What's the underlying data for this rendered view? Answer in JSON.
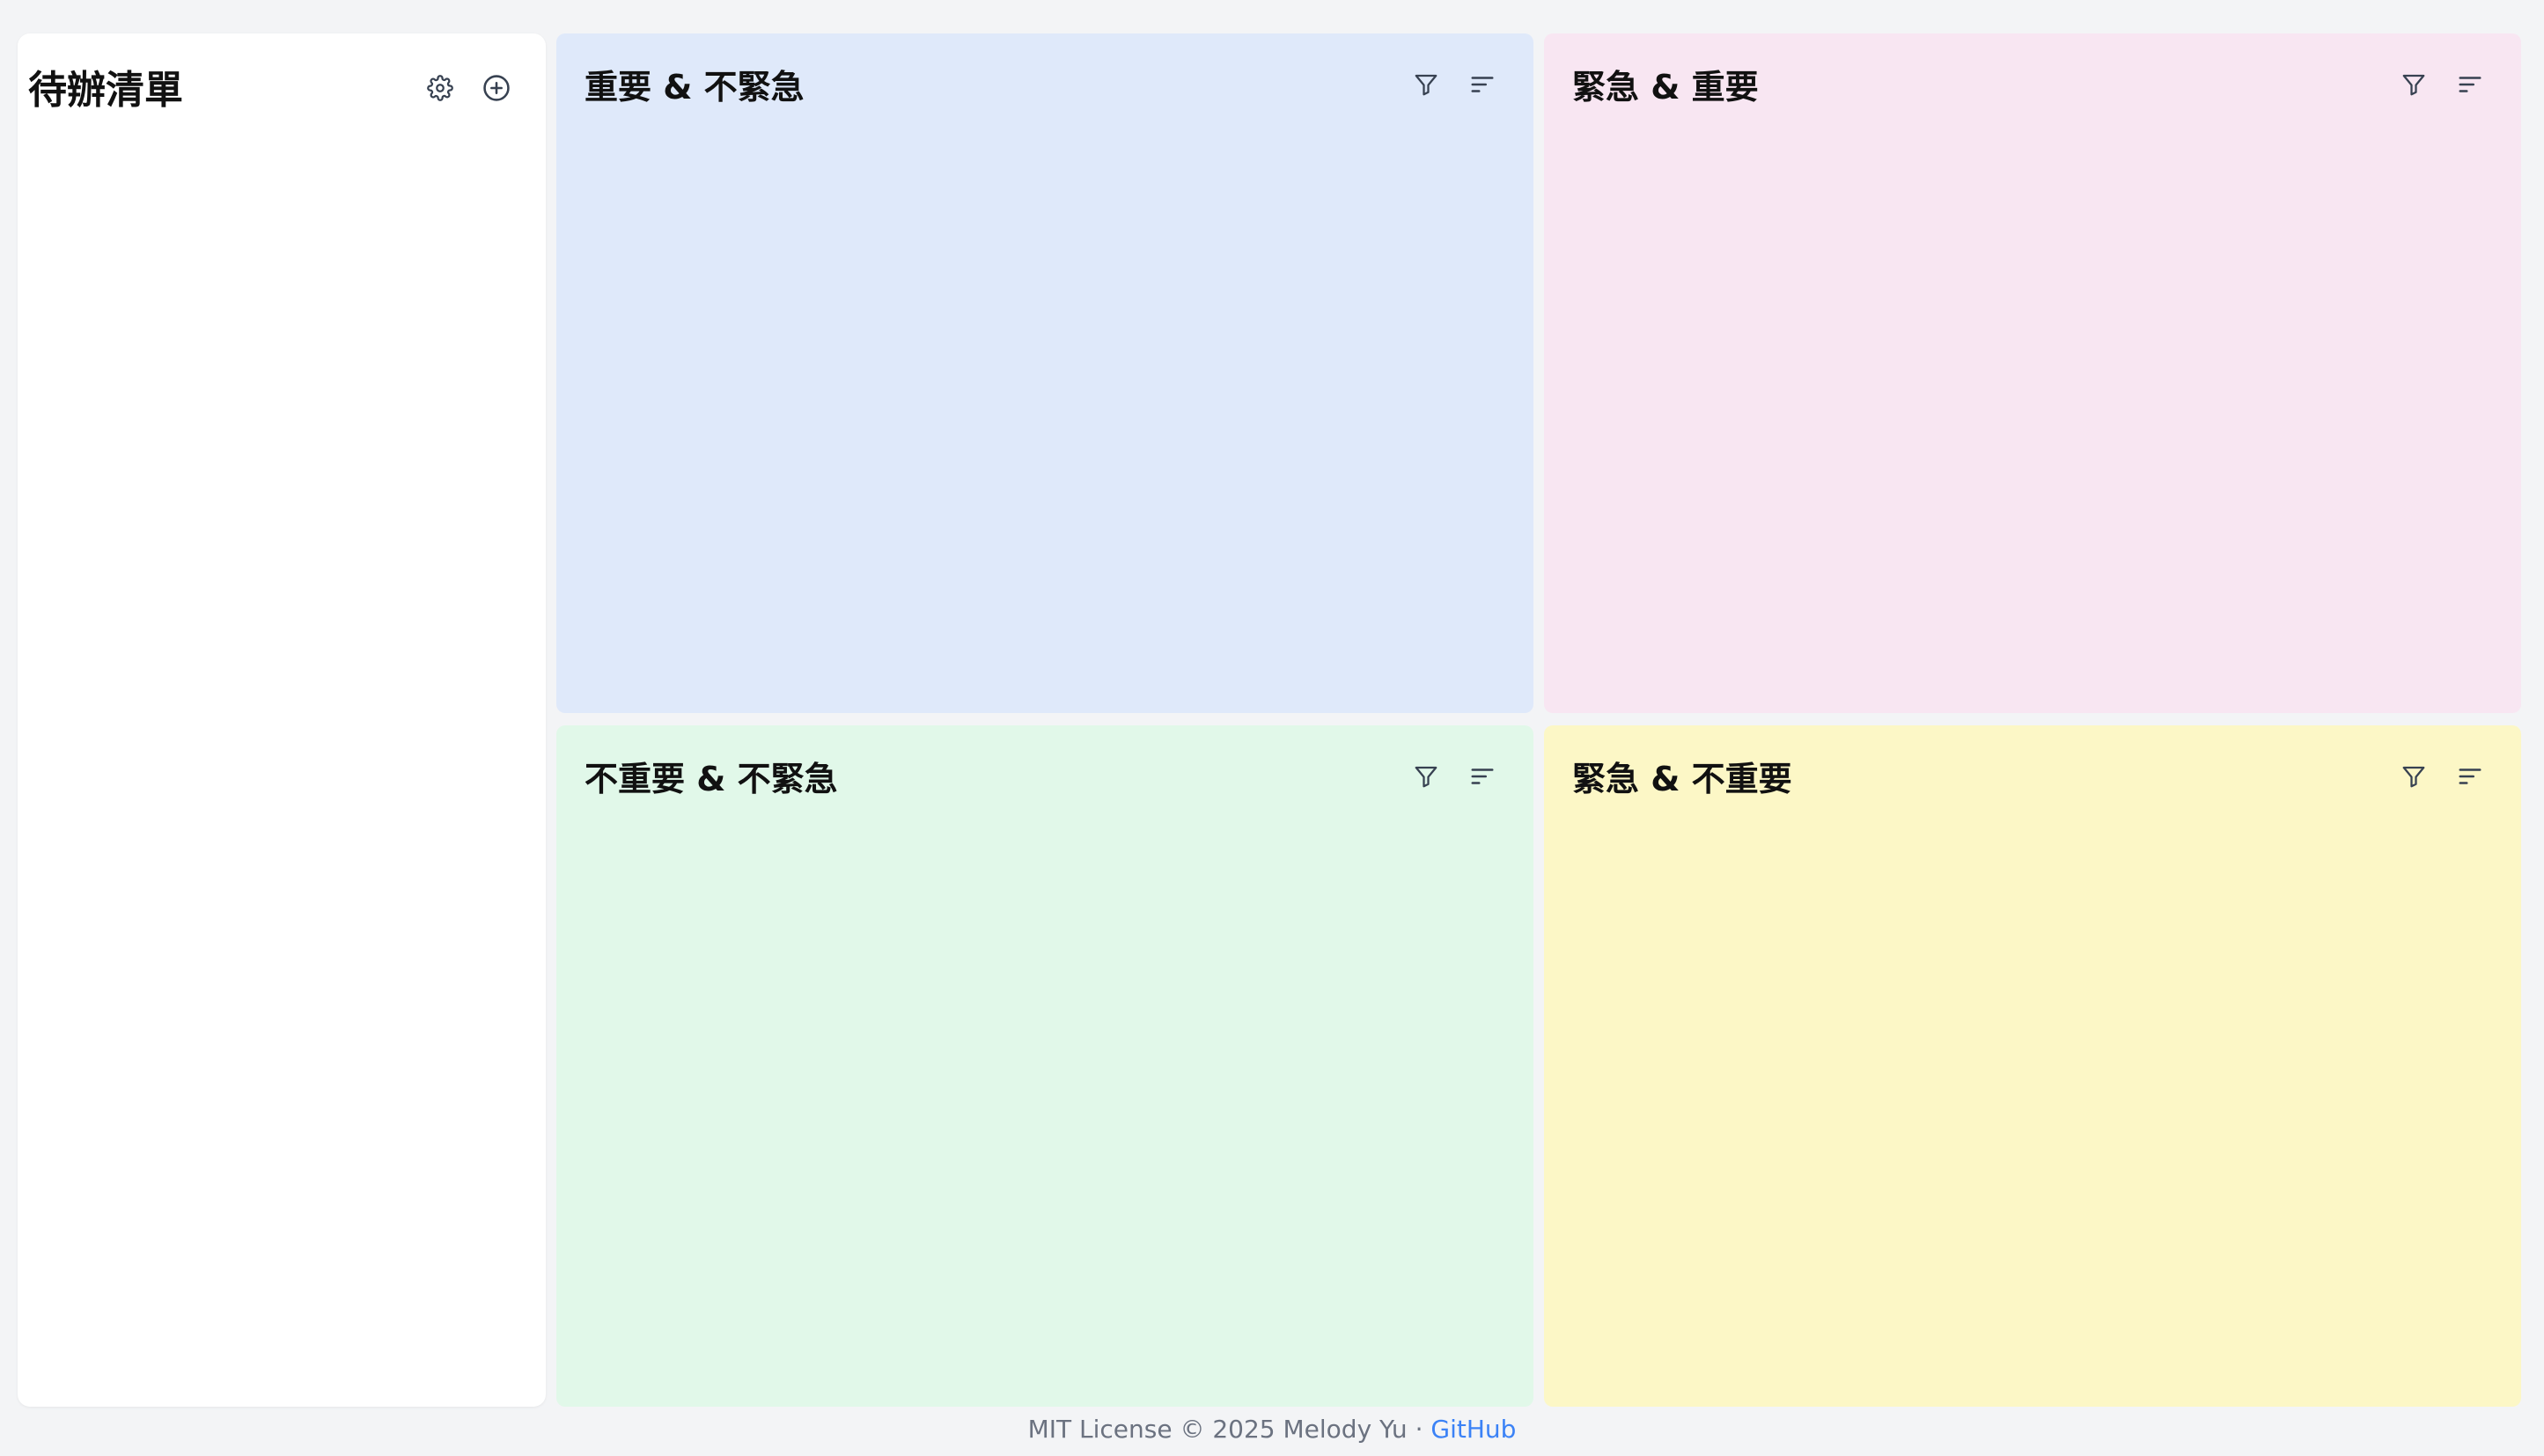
{
  "sidebar": {
    "title": "待辦清單",
    "settings_icon": "gear-icon",
    "add_icon": "plus-circle-icon"
  },
  "quadrants": [
    {
      "title": "重要 & 不緊急",
      "color": "#dfe9fa"
    },
    {
      "title": "緊急 & 重要",
      "color": "#f8e6f2"
    },
    {
      "title": "不重要 & 不緊急",
      "color": "#e1f8e9"
    },
    {
      "title": "緊急 & 不重要",
      "color": "#fcf7c6"
    }
  ],
  "tools": {
    "filter_icon": "filter-icon",
    "sort_icon": "sort-icon"
  },
  "footer": {
    "text": "MIT License © 2025 Melody Yu · ",
    "link": "GitHub"
  }
}
